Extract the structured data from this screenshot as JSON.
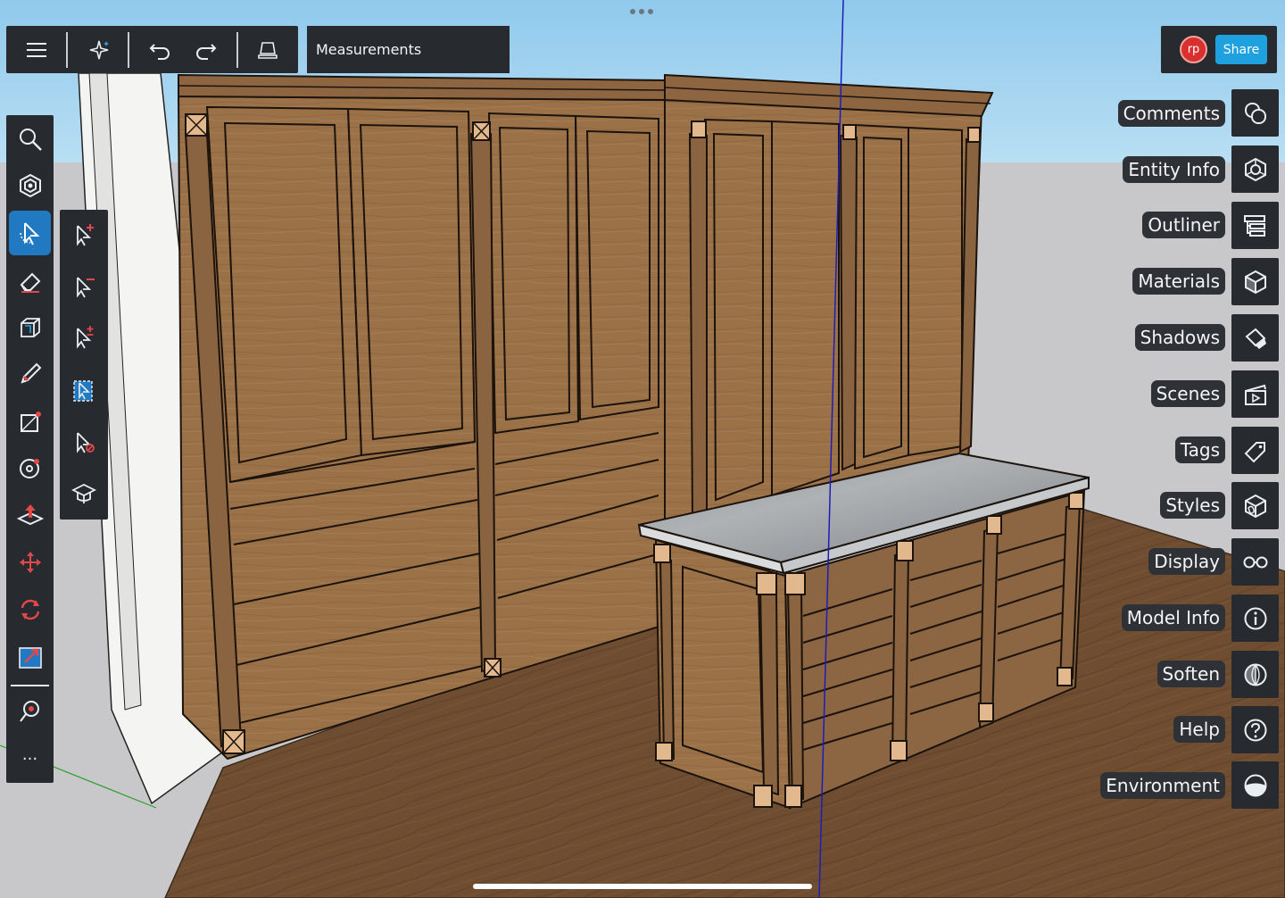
{
  "toolbar": {
    "measurements_label": "Measurements",
    "buttons": [
      {
        "name": "menu-icon"
      },
      {
        "name": "sparkle-icon"
      },
      {
        "name": "undo-icon"
      },
      {
        "name": "redo-icon"
      },
      {
        "name": "display-mode-icon"
      }
    ]
  },
  "user": {
    "initials": "rp",
    "share_label": "Share"
  },
  "left_tools": [
    "search-icon",
    "orbit-icon",
    "select-icon",
    "eraser-icon",
    "box-icon",
    "pencil-icon",
    "rectangle-icon",
    "circle-icon",
    "push-pull-icon",
    "move-icon",
    "rotate-icon",
    "scale-icon",
    "tape-measure-icon",
    "more-icon"
  ],
  "left_more_label": "···",
  "sub_tools": [
    "select-add-icon",
    "select-subtract-icon",
    "select-toggle-icon",
    "select-box-icon",
    "select-clear-icon",
    "learn-icon"
  ],
  "panels": [
    {
      "label": "Comments",
      "icon": "comments-icon"
    },
    {
      "label": "Entity Info",
      "icon": "entity-info-icon"
    },
    {
      "label": "Outliner",
      "icon": "outliner-icon"
    },
    {
      "label": "Materials",
      "icon": "materials-icon"
    },
    {
      "label": "Shadows",
      "icon": "shadows-icon"
    },
    {
      "label": "Scenes",
      "icon": "scenes-icon"
    },
    {
      "label": "Tags",
      "icon": "tags-icon"
    },
    {
      "label": "Styles",
      "icon": "styles-icon"
    },
    {
      "label": "Display",
      "icon": "display-icon"
    },
    {
      "label": "Model Info",
      "icon": "model-info-icon"
    },
    {
      "label": "Soften",
      "icon": "soften-icon"
    },
    {
      "label": "Help",
      "icon": "help-icon"
    },
    {
      "label": "Environment",
      "icon": "environment-icon"
    }
  ],
  "colors": {
    "sky": "#9fd1ef",
    "ground": "#c9c9cb",
    "floor": "#6e4c30",
    "wood": "#9a7049",
    "countertop": "#9ea2a6",
    "toolbar": "#272a2f",
    "accent": "#2079c1",
    "share": "#1fa0df",
    "avatar": "#d8302f"
  }
}
